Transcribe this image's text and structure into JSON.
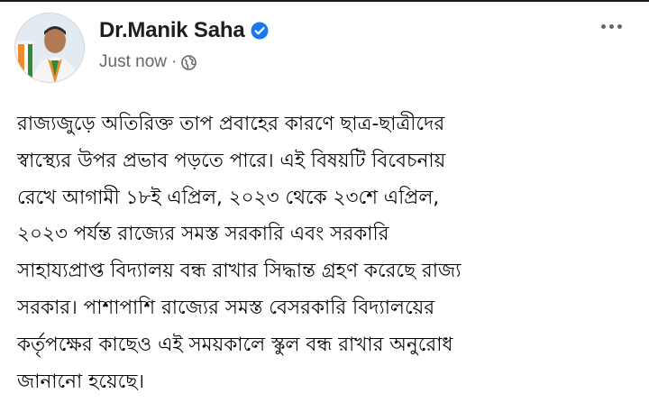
{
  "post": {
    "author": {
      "name": "Dr.Manik Saha",
      "verified": true,
      "avatar": "profile-photo"
    },
    "timestamp": "Just now",
    "separator": "·",
    "privacy_icon": "globe-icon",
    "more_icon": "more-options-icon",
    "text_lines": [
      "রাজ্যজুড়ে অতিরিক্ত তাপ প্রবাহের কারণে ছাত্র-ছাত্রীদের",
      "স্বাস্থ্যের উপর প্রভাব পড়তে পারে। এই বিষয়টি বিবেচনায়",
      "রেখে আগামী ১৮ই এপ্রিল, ২০২৩ থেকে ২৩শে এপ্রিল,",
      "২০২৩ পর্যন্ত রাজ্যের সমস্ত সরকারি এবং সরকারি",
      "সাহায্যপ্রাপ্ত বিদ্যালয় বন্ধ রাখার সিদ্ধান্ত গ্রহণ করেছে রাজ্য",
      "সরকার। পাশাপাশি রাজ্যের সমস্ত বেসরকারি বিদ্যালয়ের",
      "কর্তৃপক্ষের কাছেও এই সময়কালে স্কুল বন্ধ রাখার অনুরোধ",
      "জানানো হয়েছে।"
    ]
  },
  "colors": {
    "name": "#1c1e21",
    "meta": "#65676b",
    "verified_badge": "#1877f2",
    "body_text": "#050505"
  }
}
